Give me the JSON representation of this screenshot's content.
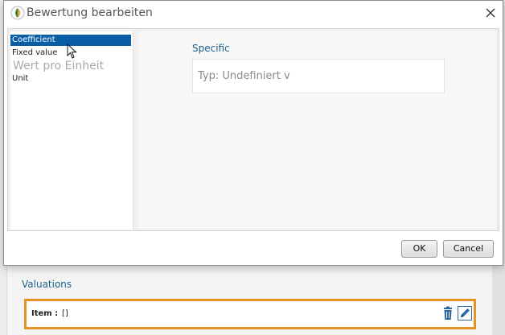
{
  "dialog": {
    "title": "Bewertung bearbeiten",
    "ok_label": "OK",
    "cancel_label": "Cancel"
  },
  "list": {
    "items": [
      {
        "label": "Coefficient",
        "selected": true
      },
      {
        "label": "Fixed value",
        "selected": false
      },
      {
        "label": "Unit",
        "selected": false
      }
    ],
    "ghost_text": "Wert pro Einheit"
  },
  "content": {
    "section_label": "Specific",
    "type_field_text": "Typ: Undefiniert v"
  },
  "background": {
    "section_title": "Valuations",
    "item_label": "Item :",
    "item_value": "[]"
  },
  "icons": {
    "app": "app-logo-icon",
    "close": "close-icon",
    "cursor": "mouse-pointer-icon",
    "delete": "trash-icon",
    "edit": "pencil-icon"
  },
  "colors": {
    "selection": "#0a5ea6",
    "label_blue": "#1f5f8b",
    "highlight_border": "#e69324"
  }
}
